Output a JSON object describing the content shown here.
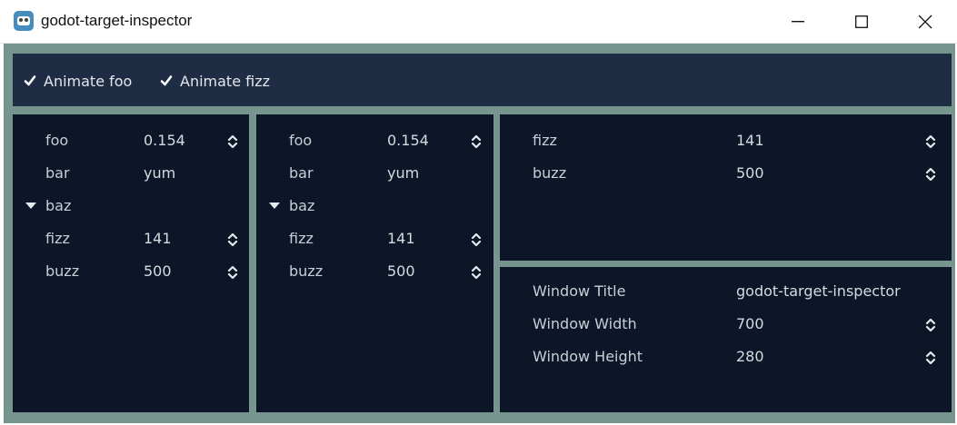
{
  "window": {
    "title": "godot-target-inspector",
    "minimize_icon": "minimize-icon",
    "maximize_icon": "maximize-icon",
    "close_icon": "close-icon"
  },
  "toolbar": {
    "animate_foo": {
      "label": "Animate foo",
      "checked": true
    },
    "animate_fizz": {
      "label": "Animate fizz",
      "checked": true
    }
  },
  "inspector1": {
    "foo": {
      "label": "foo",
      "value": "0.154"
    },
    "bar": {
      "label": "bar",
      "value": "yum"
    },
    "baz": {
      "label": "baz"
    },
    "fizz": {
      "label": "fizz",
      "value": "141"
    },
    "buzz": {
      "label": "buzz",
      "value": "500"
    }
  },
  "inspector2": {
    "foo": {
      "label": "foo",
      "value": "0.154"
    },
    "bar": {
      "label": "bar",
      "value": "yum"
    },
    "baz": {
      "label": "baz"
    },
    "fizz": {
      "label": "fizz",
      "value": "141"
    },
    "buzz": {
      "label": "buzz",
      "value": "500"
    }
  },
  "inspector3": {
    "fizz": {
      "label": "fizz",
      "value": "141"
    },
    "buzz": {
      "label": "buzz",
      "value": "500"
    }
  },
  "window_settings": {
    "title": {
      "label": "Window Title",
      "value": "godot-target-inspector"
    },
    "width": {
      "label": "Window Width",
      "value": "700"
    },
    "height": {
      "label": "Window Height",
      "value": "280"
    }
  },
  "colors": {
    "background": "#75958e",
    "panel": "#0d1628",
    "toolbar": "#1e2d44",
    "text": "#c9ced6"
  }
}
